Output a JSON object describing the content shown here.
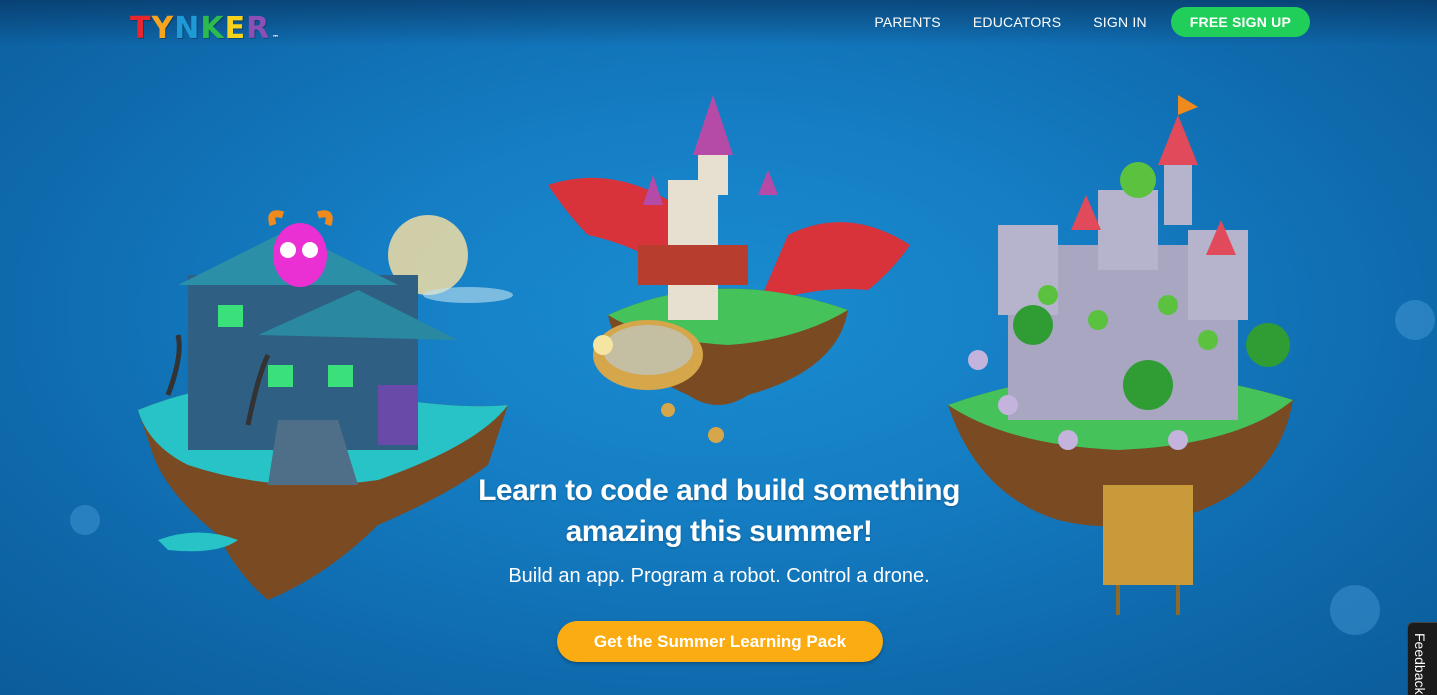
{
  "brand": {
    "logo_letters": [
      "T",
      "Y",
      "N",
      "K",
      "E",
      "R"
    ],
    "logo_colors": [
      "#e8262d",
      "#f7a51e",
      "#1f9ad6",
      "#2cbc4e",
      "#f6d21c",
      "#8c4fb4"
    ],
    "trademark": "™"
  },
  "nav": {
    "parents": "PARENTS",
    "educators": "EDUCATORS",
    "sign_in": "SIGN IN",
    "free_sign_up": "FREE SIGN UP"
  },
  "hero": {
    "headline_line1": "Learn to code and build something",
    "headline_line2": "amazing this summer!",
    "subheadline": "Build an app. Program a robot. Control a drone.",
    "cta": "Get the Summer Learning Pack"
  },
  "feedback": {
    "label": "Feedback"
  },
  "colors": {
    "background": "#157ec4",
    "signup_green": "#1fcf5a",
    "cta_orange": "#fbac12"
  },
  "illustrations": {
    "left": "haunted-house-island",
    "center": "dragon-airship-island",
    "right": "goblin-castle-island"
  }
}
